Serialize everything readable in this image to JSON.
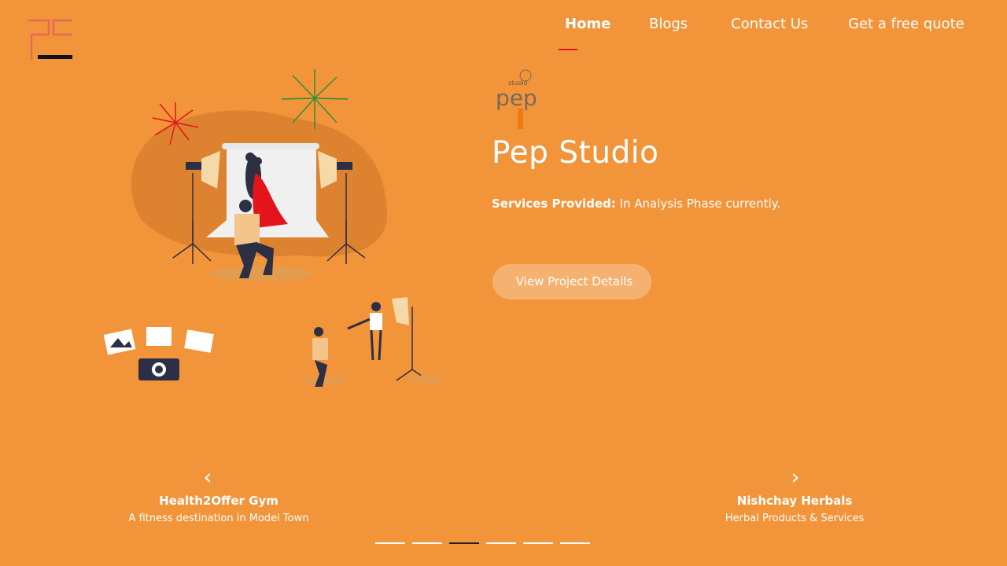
{
  "nav": {
    "items": [
      {
        "label": "Home",
        "active": true
      },
      {
        "label": "Blogs"
      },
      {
        "label": "Contact Us"
      },
      {
        "label": "Get a free quote"
      }
    ]
  },
  "project": {
    "logo_icon": "studio-pep-logo",
    "title": "Pep Studio",
    "services_label": "Services Provided:",
    "services_value": "In Analysis Phase currently.",
    "button_label": "View Project Details"
  },
  "slider": {
    "prev": {
      "name": "Health2Offer Gym",
      "desc": "A fitness destination in Model Town"
    },
    "next": {
      "name": "Nishchay Herbals",
      "desc": "Herbal Products & Services"
    },
    "prev_icon": "chevron-left-icon",
    "next_icon": "chevron-right-icon",
    "dot_count": 6,
    "active_dot": 3
  },
  "colors": {
    "background": "#f2943a",
    "accent": "#e3141b",
    "logo_red": "#e24b4b"
  }
}
